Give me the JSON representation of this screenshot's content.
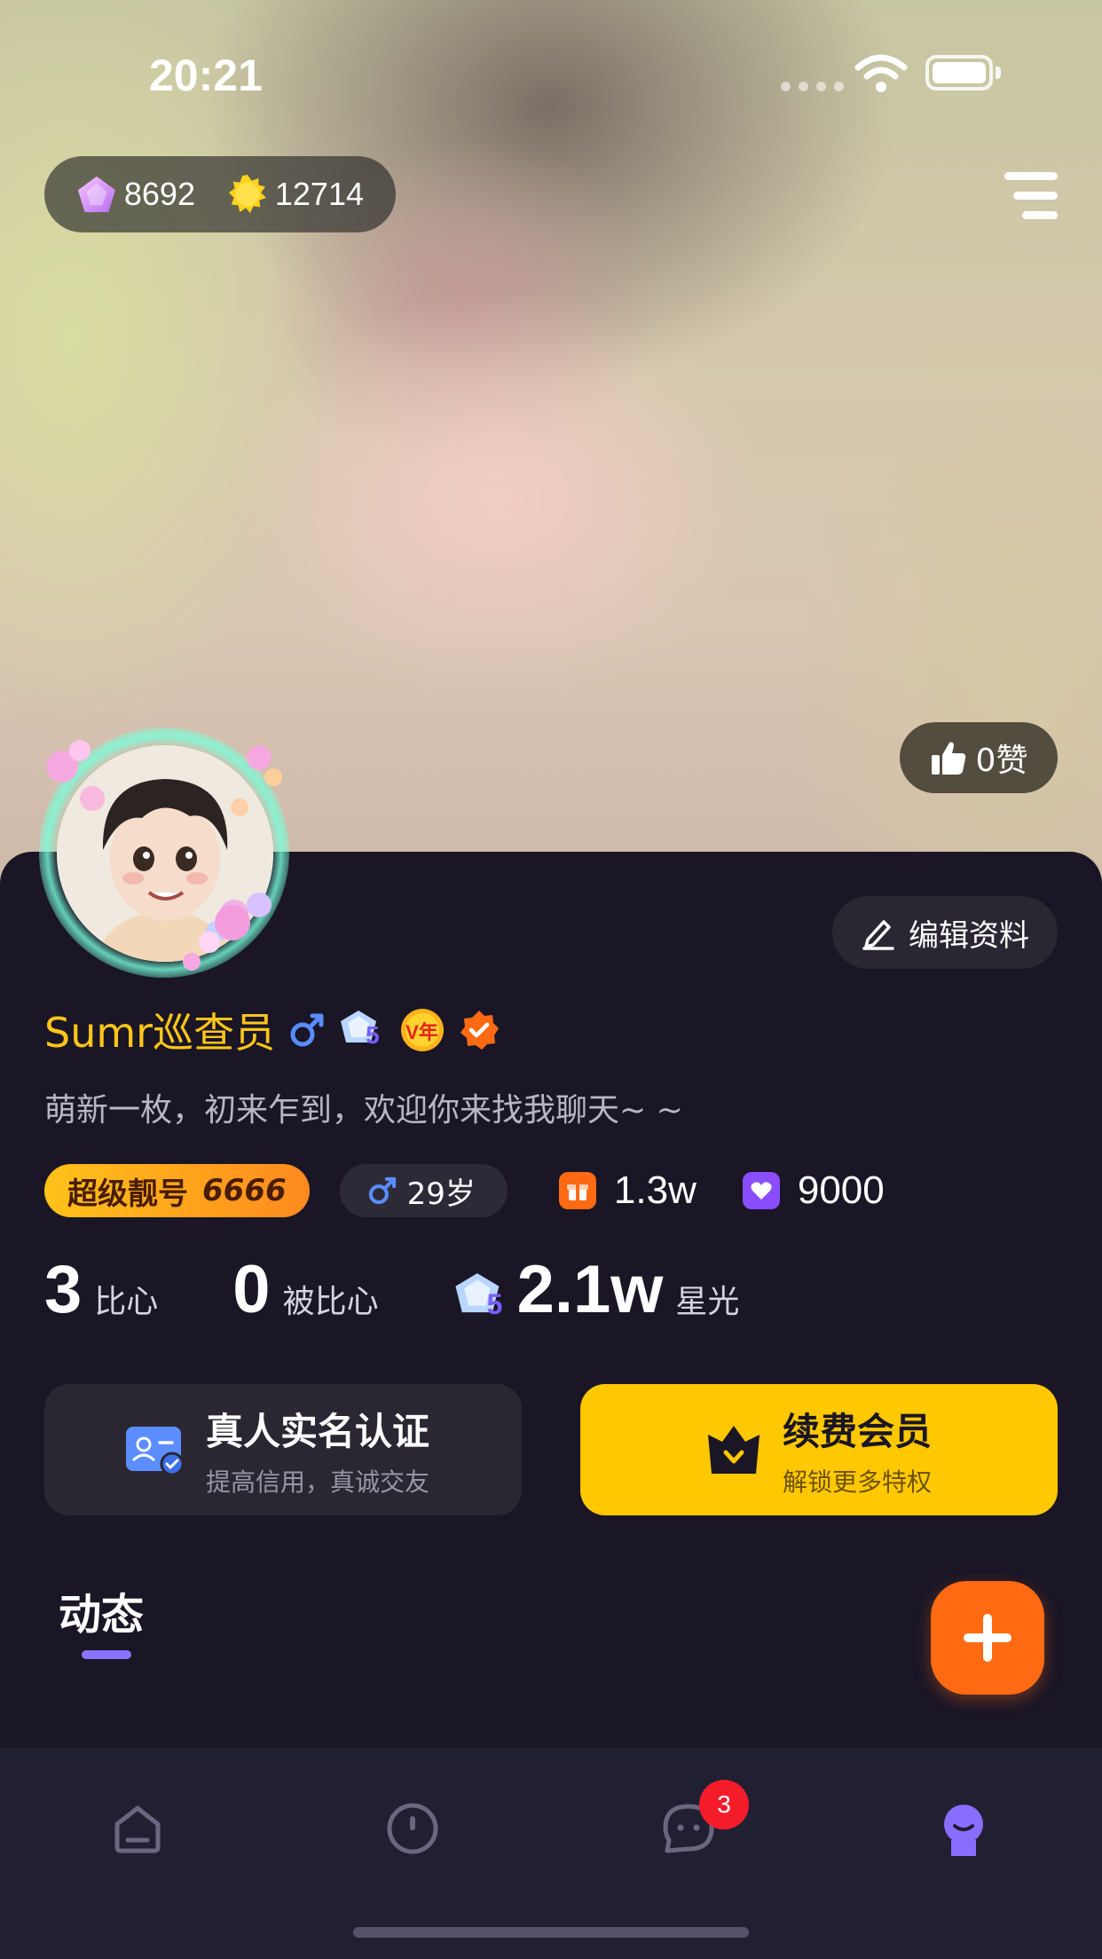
{
  "status_bar": {
    "time": "20:21"
  },
  "wallet": {
    "diamonds": "8692",
    "coins": "12714"
  },
  "likes": {
    "label": "0赞"
  },
  "profile": {
    "name": "Sumr巡查员",
    "level_badge": "5",
    "vip_badge": "V年",
    "bio": "萌新一枚，初来乍到，欢迎你来找我聊天~ ~",
    "edit_button": "编辑资料"
  },
  "tags": {
    "super_number_label": "超级靓号",
    "super_number": "6666",
    "age": "29岁",
    "gift_value": "1.3w",
    "heart_value": "9000"
  },
  "counts": {
    "hearts_num": "3",
    "hearts_label": "比心",
    "hearted_num": "0",
    "hearted_label": "被比心",
    "starlight_badge": "5",
    "starlight_num": "2.1w",
    "starlight_label": "星光"
  },
  "cards": {
    "verify_title": "真人实名认证",
    "verify_sub": "提高信用，真诚交友",
    "vip_title": "续费会员",
    "vip_sub": "解锁更多特权"
  },
  "tabs": {
    "moments": "动态"
  },
  "tabbar": {
    "items": [
      "home-icon",
      "discover-icon",
      "messages-icon",
      "profile-icon"
    ],
    "messages_badge": "3",
    "active_color": "#8a6cff"
  },
  "colors": {
    "accent": "#ffc51a",
    "fab": "#ff6a13",
    "vip_card": "#ffc800"
  }
}
